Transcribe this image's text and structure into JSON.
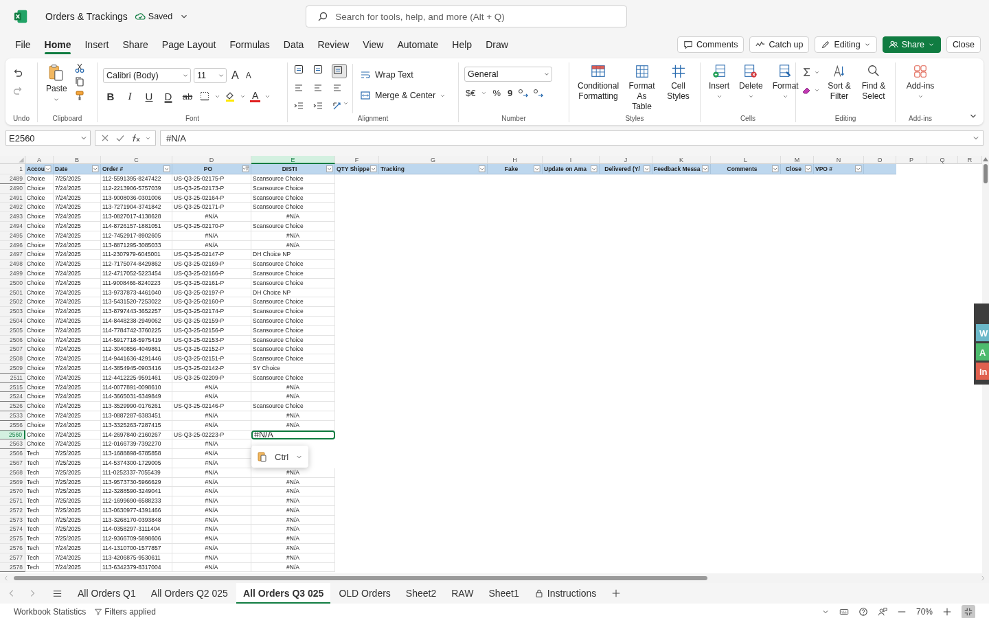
{
  "app_bar": {
    "title": "Orders & Trackings",
    "save_status": "Saved",
    "search": {
      "placeholder": "Search for tools, help, and more (Alt + Q)"
    }
  },
  "menu_tabs": [
    {
      "label": "File",
      "selected": false
    },
    {
      "label": "Home",
      "selected": true
    },
    {
      "label": "Insert",
      "selected": false
    },
    {
      "label": "Share",
      "selected": false
    },
    {
      "label": "Page Layout",
      "selected": false
    },
    {
      "label": "Formulas",
      "selected": false
    },
    {
      "label": "Data",
      "selected": false
    },
    {
      "label": "Review",
      "selected": false
    },
    {
      "label": "View",
      "selected": false
    },
    {
      "label": "Automate",
      "selected": false
    },
    {
      "label": "Help",
      "selected": false
    },
    {
      "label": "Draw",
      "selected": false
    }
  ],
  "actions": [
    {
      "label": "Comments",
      "kind": "comments"
    },
    {
      "label": "Catch up",
      "kind": "catchup"
    },
    {
      "label": "Editing",
      "kind": "editing"
    },
    {
      "label": "Share",
      "kind": "share"
    },
    {
      "label": "Close",
      "kind": "plain"
    }
  ],
  "ribbon": {
    "undo": {
      "label": "Undo"
    },
    "clipboard": {
      "label": "Clipboard",
      "paste": "Paste"
    },
    "font": {
      "label": "Font",
      "family": "Calibri (Body)",
      "size": "11",
      "grow": "A",
      "shrink": "A",
      "styles": [
        "B",
        "I",
        "U",
        "D",
        "ab"
      ],
      "font_color": "A"
    },
    "alignment": {
      "label": "Alignment",
      "wrap": "Wrap Text",
      "merge": "Merge & Center"
    },
    "number": {
      "label": "Number",
      "format": "General",
      "currency": "$€",
      "percent": "%",
      "comma": "9"
    },
    "styles": {
      "label": "Styles",
      "buttons": [
        "Conditional Formatting",
        "Format As Table",
        "Cell Styles"
      ]
    },
    "cells": {
      "label": "Cells",
      "buttons": [
        "Insert",
        "Delete",
        "Format"
      ]
    },
    "editing": {
      "label": "Editing",
      "buttons": [
        "Sort & Filter",
        "Find & Select"
      ]
    },
    "addins": {
      "label": "Add-ins",
      "button": "Add-ins"
    }
  },
  "formula_bar": {
    "name_box": "E2560",
    "formula": "#N/A"
  },
  "columns": [
    {
      "letter": "A",
      "selected": false
    },
    {
      "letter": "B",
      "selected": false
    },
    {
      "letter": "C",
      "selected": false
    },
    {
      "letter": "D",
      "selected": false
    },
    {
      "letter": "E",
      "selected": true
    },
    {
      "letter": "F",
      "selected": false
    },
    {
      "letter": "G",
      "selected": false
    },
    {
      "letter": "H",
      "selected": false
    },
    {
      "letter": "I",
      "selected": false
    },
    {
      "letter": "J",
      "selected": false
    },
    {
      "letter": "K",
      "selected": false
    },
    {
      "letter": "L",
      "selected": false
    },
    {
      "letter": "M",
      "selected": false
    },
    {
      "letter": "N",
      "selected": false
    },
    {
      "letter": "O",
      "selected": false
    },
    {
      "letter": "P",
      "selected": false
    },
    {
      "letter": "Q",
      "selected": false
    },
    {
      "letter": "R",
      "selected": false
    }
  ],
  "header_row": {
    "row": "1",
    "headers": [
      {
        "label": "Accou",
        "filtered": false
      },
      {
        "label": "Date",
        "centered": false,
        "filtered": false
      },
      {
        "label": "Order #",
        "centered": false,
        "filtered": false
      },
      {
        "label": "PO",
        "centered": true,
        "filtered": true
      },
      {
        "label": "DISTI",
        "centered": true,
        "filtered": false
      },
      {
        "label": "QTY Shippe",
        "centered": false,
        "filtered": false
      },
      {
        "label": "Tracking",
        "centered": false,
        "filtered": false
      },
      {
        "label": "Fake",
        "centered": true,
        "filtered": false
      },
      {
        "label": "Update on Ama",
        "centered": false,
        "filtered": false
      },
      {
        "label": "Delivered (Y/",
        "centered": true,
        "filtered": false
      },
      {
        "label": "Feedback Messa",
        "centered": false,
        "filtered": false
      },
      {
        "label": "Comments",
        "centered": true,
        "filtered": false
      },
      {
        "label": "Close",
        "centered": true,
        "filtered": false
      },
      {
        "label": "VPO #",
        "centered": false,
        "filtered": false
      }
    ]
  },
  "rows": [
    {
      "row": "2489",
      "account": "Choice",
      "date": "7/25/2025",
      "order": "112-5591395-8247422",
      "po": "US-Q3-25-02175-P",
      "disti": "Scansource Choice",
      "po_error": false,
      "disti_error": false,
      "hidden_after": true,
      "selected": false
    },
    {
      "row": "2490",
      "account": "Choice",
      "date": "7/24/2025",
      "order": "112-2213906-5757039",
      "po": "US-Q3-25-02173-P",
      "disti": "Scansource Choice",
      "po_error": false,
      "disti_error": false,
      "hidden_after": false,
      "selected": false
    },
    {
      "row": "2491",
      "account": "Choice",
      "date": "7/24/2025",
      "order": "113-9008036-0301006",
      "po": "US-Q3-25-02164-P",
      "disti": "Scansource Choice",
      "po_error": false,
      "disti_error": false,
      "hidden_after": false,
      "selected": false
    },
    {
      "row": "2492",
      "account": "Choice",
      "date": "7/24/2025",
      "order": "113-7271904-3741842",
      "po": "US-Q3-25-02171-P",
      "disti": "Scansource Choice",
      "po_error": false,
      "disti_error": false,
      "hidden_after": false,
      "selected": false
    },
    {
      "row": "2493",
      "account": "Choice",
      "date": "7/24/2025",
      "order": "113-0827017-4138628",
      "po": "#N/A",
      "disti": "#N/A",
      "po_error": true,
      "disti_error": true,
      "hidden_after": false,
      "selected": false
    },
    {
      "row": "2494",
      "account": "Choice",
      "date": "7/24/2025",
      "order": "114-8726157-1881051",
      "po": "US-Q3-25-02170-P",
      "disti": "Scansource Choice",
      "po_error": false,
      "disti_error": false,
      "hidden_after": false,
      "selected": false
    },
    {
      "row": "2495",
      "account": "Choice",
      "date": "7/24/2025",
      "order": "112-7452917-8902605",
      "po": "#N/A",
      "disti": "#N/A",
      "po_error": true,
      "disti_error": true,
      "hidden_after": false,
      "selected": false
    },
    {
      "row": "2496",
      "account": "Choice",
      "date": "7/24/2025",
      "order": "113-8871295-3085033",
      "po": "#N/A",
      "disti": "#N/A",
      "po_error": true,
      "disti_error": true,
      "hidden_after": false,
      "selected": false
    },
    {
      "row": "2497",
      "account": "Choice",
      "date": "7/24/2025",
      "order": "111-2307979-6045001",
      "po": "US-Q3-25-02147-P",
      "disti": "DH Choice NP",
      "po_error": false,
      "disti_error": false,
      "hidden_after": false,
      "selected": false
    },
    {
      "row": "2498",
      "account": "Choice",
      "date": "7/24/2025",
      "order": "112-7175074-8429862",
      "po": "US-Q3-25-02169-P",
      "disti": "Scansource Choice",
      "po_error": false,
      "disti_error": false,
      "hidden_after": false,
      "selected": false
    },
    {
      "row": "2499",
      "account": "Choice",
      "date": "7/24/2025",
      "order": "112-4717052-5223454",
      "po": "US-Q3-25-02166-P",
      "disti": "Scansource Choice",
      "po_error": false,
      "disti_error": false,
      "hidden_after": false,
      "selected": false
    },
    {
      "row": "2500",
      "account": "Choice",
      "date": "7/24/2025",
      "order": "111-9008466-8240223",
      "po": "US-Q3-25-02161-P",
      "disti": "Scansource Choice",
      "po_error": false,
      "disti_error": false,
      "hidden_after": false,
      "selected": false
    },
    {
      "row": "2501",
      "account": "Choice",
      "date": "7/24/2025",
      "order": "113-9737873-4461040",
      "po": "US-Q3-25-02197-P",
      "disti": "DH Choice NP",
      "po_error": false,
      "disti_error": false,
      "hidden_after": false,
      "selected": false
    },
    {
      "row": "2502",
      "account": "Choice",
      "date": "7/24/2025",
      "order": "113-5431520-7253022",
      "po": "US-Q3-25-02160-P",
      "disti": "Scansource Choice",
      "po_error": false,
      "disti_error": false,
      "hidden_after": false,
      "selected": false
    },
    {
      "row": "2503",
      "account": "Choice",
      "date": "7/24/2025",
      "order": "113-8797443-3652257",
      "po": "US-Q3-25-02174-P",
      "disti": "Scansource Choice",
      "po_error": false,
      "disti_error": false,
      "hidden_after": false,
      "selected": false
    },
    {
      "row": "2504",
      "account": "Choice",
      "date": "7/24/2025",
      "order": "114-8448238-2949062",
      "po": "US-Q3-25-02159-P",
      "disti": "Scansource Choice",
      "po_error": false,
      "disti_error": false,
      "hidden_after": false,
      "selected": false
    },
    {
      "row": "2505",
      "account": "Choice",
      "date": "7/24/2025",
      "order": "114-7784742-3760225",
      "po": "US-Q3-25-02156-P",
      "disti": "Scansource Choice",
      "po_error": false,
      "disti_error": false,
      "hidden_after": false,
      "selected": false
    },
    {
      "row": "2506",
      "account": "Choice",
      "date": "7/24/2025",
      "order": "114-5917718-5975419",
      "po": "US-Q3-25-02153-P",
      "disti": "Scansource Choice",
      "po_error": false,
      "disti_error": false,
      "hidden_after": false,
      "selected": false
    },
    {
      "row": "2507",
      "account": "Choice",
      "date": "7/24/2025",
      "order": "112-3040856-4049861",
      "po": "US-Q3-25-02152-P",
      "disti": "Scansource Choice",
      "po_error": false,
      "disti_error": false,
      "hidden_after": false,
      "selected": false
    },
    {
      "row": "2508",
      "account": "Choice",
      "date": "7/24/2025",
      "order": "114-9441636-4291446",
      "po": "US-Q3-25-02151-P",
      "disti": "Scansource Choice",
      "po_error": false,
      "disti_error": false,
      "hidden_after": false,
      "selected": false
    },
    {
      "row": "2509",
      "account": "Choice",
      "date": "7/24/2025",
      "order": "114-3854945-0903416",
      "po": "US-Q3-25-02142-P",
      "disti": "SY Choice",
      "po_error": false,
      "disti_error": false,
      "hidden_after": true,
      "selected": false
    },
    {
      "row": "2511",
      "account": "Choice",
      "date": "7/24/2025",
      "order": "112-4412225-9591461",
      "po": "US-Q3-25-02209-P",
      "disti": "Scansource Choice",
      "po_error": false,
      "disti_error": false,
      "hidden_after": true,
      "selected": false
    },
    {
      "row": "2515",
      "account": "Choice",
      "date": "7/24/2025",
      "order": "114-0077891-0098610",
      "po": "#N/A",
      "disti": "#N/A",
      "po_error": true,
      "disti_error": true,
      "hidden_after": true,
      "selected": false
    },
    {
      "row": "2524",
      "account": "Choice",
      "date": "7/24/2025",
      "order": "114-3665031-6349849",
      "po": "#N/A",
      "disti": "#N/A",
      "po_error": true,
      "disti_error": true,
      "hidden_after": true,
      "selected": false
    },
    {
      "row": "2526",
      "account": "Choice",
      "date": "7/24/2025",
      "order": "113-3529990-0176261",
      "po": "US-Q3-25-02146-P",
      "disti": "Scansource Choice",
      "po_error": false,
      "disti_error": false,
      "hidden_after": true,
      "selected": false
    },
    {
      "row": "2533",
      "account": "Choice",
      "date": "7/24/2025",
      "order": "113-0887287-6383451",
      "po": "#N/A",
      "disti": "#N/A",
      "po_error": true,
      "disti_error": true,
      "hidden_after": true,
      "selected": false
    },
    {
      "row": "2556",
      "account": "Choice",
      "date": "7/24/2025",
      "order": "113-3325263-7287415",
      "po": "#N/A",
      "disti": "#N/A",
      "po_error": true,
      "disti_error": true,
      "hidden_after": true,
      "selected": false
    },
    {
      "row": "2560",
      "account": "Choice",
      "date": "7/24/2025",
      "order": "114-2697840-2160267",
      "po": "US-Q3-25-02223-P",
      "disti": "#N/A",
      "po_error": false,
      "disti_error": true,
      "hidden_after": true,
      "selected": true
    },
    {
      "row": "2563",
      "account": "Choice",
      "date": "7/24/2025",
      "order": "112-0166739-7392270",
      "po": "#N/A",
      "po_error": true,
      "hidden_after": true,
      "selected": false
    },
    {
      "row": "2566",
      "account": "Tech",
      "date": "7/25/2025",
      "order": "113-1688898-6785858",
      "po": "#N/A",
      "po_error": true,
      "hidden_after": false,
      "selected": false
    },
    {
      "row": "2567",
      "account": "Tech",
      "date": "7/25/2025",
      "order": "114-5374300-1729005",
      "po": "#N/A",
      "po_error": true,
      "hidden_after": false,
      "selected": false
    },
    {
      "row": "2568",
      "account": "Tech",
      "date": "7/25/2025",
      "order": "111-0252337-7055439",
      "po": "#N/A",
      "disti": "#N/A",
      "po_error": true,
      "disti_error": true,
      "hidden_after": false,
      "selected": false
    },
    {
      "row": "2569",
      "account": "Tech",
      "date": "7/25/2025",
      "order": "113-9573730-5966629",
      "po": "#N/A",
      "disti": "#N/A",
      "po_error": true,
      "disti_error": true,
      "hidden_after": false,
      "selected": false
    },
    {
      "row": "2570",
      "account": "Tech",
      "date": "7/25/2025",
      "order": "112-3288590-3249041",
      "po": "#N/A",
      "disti": "#N/A",
      "po_error": true,
      "disti_error": true,
      "hidden_after": false,
      "selected": false
    },
    {
      "row": "2571",
      "account": "Tech",
      "date": "7/25/2025",
      "order": "112-1699690-6588233",
      "po": "#N/A",
      "disti": "#N/A",
      "po_error": true,
      "disti_error": true,
      "hidden_after": false,
      "selected": false
    },
    {
      "row": "2572",
      "account": "Tech",
      "date": "7/25/2025",
      "order": "113-0630977-4391466",
      "po": "#N/A",
      "disti": "#N/A",
      "po_error": true,
      "disti_error": true,
      "hidden_after": false,
      "selected": false
    },
    {
      "row": "2573",
      "account": "Tech",
      "date": "7/25/2025",
      "order": "113-3268170-0393848",
      "po": "#N/A",
      "disti": "#N/A",
      "po_error": true,
      "disti_error": true,
      "hidden_after": false,
      "selected": false
    },
    {
      "row": "2574",
      "account": "Tech",
      "date": "7/25/2025",
      "order": "114-0358297-3111404",
      "po": "#N/A",
      "disti": "#N/A",
      "po_error": true,
      "disti_error": true,
      "hidden_after": false,
      "selected": false
    },
    {
      "row": "2575",
      "account": "Tech",
      "date": "7/25/2025",
      "order": "112-9366709-5898606",
      "po": "#N/A",
      "disti": "#N/A",
      "po_error": true,
      "disti_error": true,
      "hidden_after": false,
      "selected": false
    },
    {
      "row": "2576",
      "account": "Tech",
      "date": "7/24/2025",
      "order": "114-1310700-1577857",
      "po": "#N/A",
      "disti": "#N/A",
      "po_error": true,
      "disti_error": true,
      "hidden_after": false,
      "selected": false
    },
    {
      "row": "2577",
      "account": "Tech",
      "date": "7/24/2025",
      "order": "113-4206875-9530611",
      "po": "#N/A",
      "disti": "#N/A",
      "po_error": true,
      "disti_error": true,
      "hidden_after": false,
      "selected": false
    },
    {
      "row": "2578",
      "account": "Tech",
      "date": "7/24/2025",
      "order": "113-6342379-8317004",
      "po": "#N/A",
      "disti": "#N/A",
      "po_error": true,
      "disti_error": true,
      "hidden_after": true,
      "selected": false
    }
  ],
  "paste_popup": {
    "label": "Ctrl"
  },
  "side_panel": {
    "tabs": [
      {
        "label": "W",
        "color": "#6bb8c9"
      },
      {
        "label": "A",
        "color": "#4dbb6e"
      },
      {
        "label": "In",
        "color": "#e0604f"
      }
    ]
  },
  "sheet_tabs": [
    {
      "label": "All Orders Q1",
      "selected": false,
      "locked": false
    },
    {
      "label": "All Orders Q2 025",
      "selected": false,
      "locked": false
    },
    {
      "label": "All Orders Q3 025",
      "selected": true,
      "locked": false
    },
    {
      "label": "OLD Orders",
      "selected": false,
      "locked": false
    },
    {
      "label": "Sheet2",
      "selected": false,
      "locked": false
    },
    {
      "label": "RAW",
      "selected": false,
      "locked": false
    },
    {
      "label": "Sheet1",
      "selected": false,
      "locked": false
    },
    {
      "label": "Instructions",
      "selected": false,
      "locked": true
    }
  ],
  "status_bar": {
    "statistics": "Workbook Statistics",
    "filters": "Filters applied",
    "zoom": "70%"
  }
}
